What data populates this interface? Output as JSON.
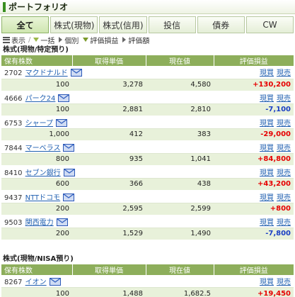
{
  "header": {
    "title": "ポートフォリオ"
  },
  "tabs": [
    {
      "label": "全て",
      "active": true
    },
    {
      "label": "株式(現物)",
      "active": false
    },
    {
      "label": "株式(信用)",
      "active": false
    },
    {
      "label": "投信",
      "active": false
    },
    {
      "label": "債券",
      "active": false
    },
    {
      "label": "CW",
      "active": false
    }
  ],
  "toolbar": {
    "display": "表示",
    "slash": "/",
    "bulk": "一括",
    "individual": "個別",
    "gain": "評価損益",
    "amount": "評価額"
  },
  "columns": {
    "qty": "保有株数",
    "cost": "取得単価",
    "price": "現在値",
    "pl": "評価損益"
  },
  "actions": {
    "buy": "現買",
    "sell": "現売"
  },
  "sections": [
    {
      "title": "株式(現物/特定預り)",
      "rows": [
        {
          "code": "2702",
          "name": "マクドナルド",
          "qty": "100",
          "cost": "3,278",
          "price": "4,580",
          "pl": "+130,200",
          "sign": "pos"
        },
        {
          "code": "4666",
          "name": "パーク24",
          "qty": "100",
          "cost": "2,881",
          "price": "2,810",
          "pl": "-7,100",
          "sign": "neg"
        },
        {
          "code": "6753",
          "name": "シャープ",
          "qty": "1,000",
          "cost": "412",
          "price": "383",
          "pl": "-29,000",
          "sign": "pos"
        },
        {
          "code": "7844",
          "name": "マーベラス",
          "qty": "800",
          "cost": "935",
          "price": "1,041",
          "pl": "+84,800",
          "sign": "pos"
        },
        {
          "code": "8410",
          "name": "セブン銀行",
          "qty": "600",
          "cost": "366",
          "price": "438",
          "pl": "+43,200",
          "sign": "pos"
        },
        {
          "code": "9437",
          "name": "NTTドコモ",
          "qty": "200",
          "cost": "2,595",
          "price": "2,599",
          "pl": "+800",
          "sign": "pos"
        },
        {
          "code": "9503",
          "name": "関西電力",
          "qty": "200",
          "cost": "1,529",
          "price": "1,490",
          "pl": "-7,800",
          "sign": "neg"
        }
      ]
    },
    {
      "title": "株式(現物/NISA預り)",
      "rows": [
        {
          "code": "8267",
          "name": "イオン",
          "qty": "100",
          "cost": "1,488",
          "price": "1,682.5",
          "pl": "+19,450",
          "sign": "pos"
        }
      ]
    }
  ],
  "colors": {
    "accent": "#8dae5b",
    "positive": "#e60000",
    "negative": "#1a3fc4",
    "link": "#1f5fb0"
  }
}
